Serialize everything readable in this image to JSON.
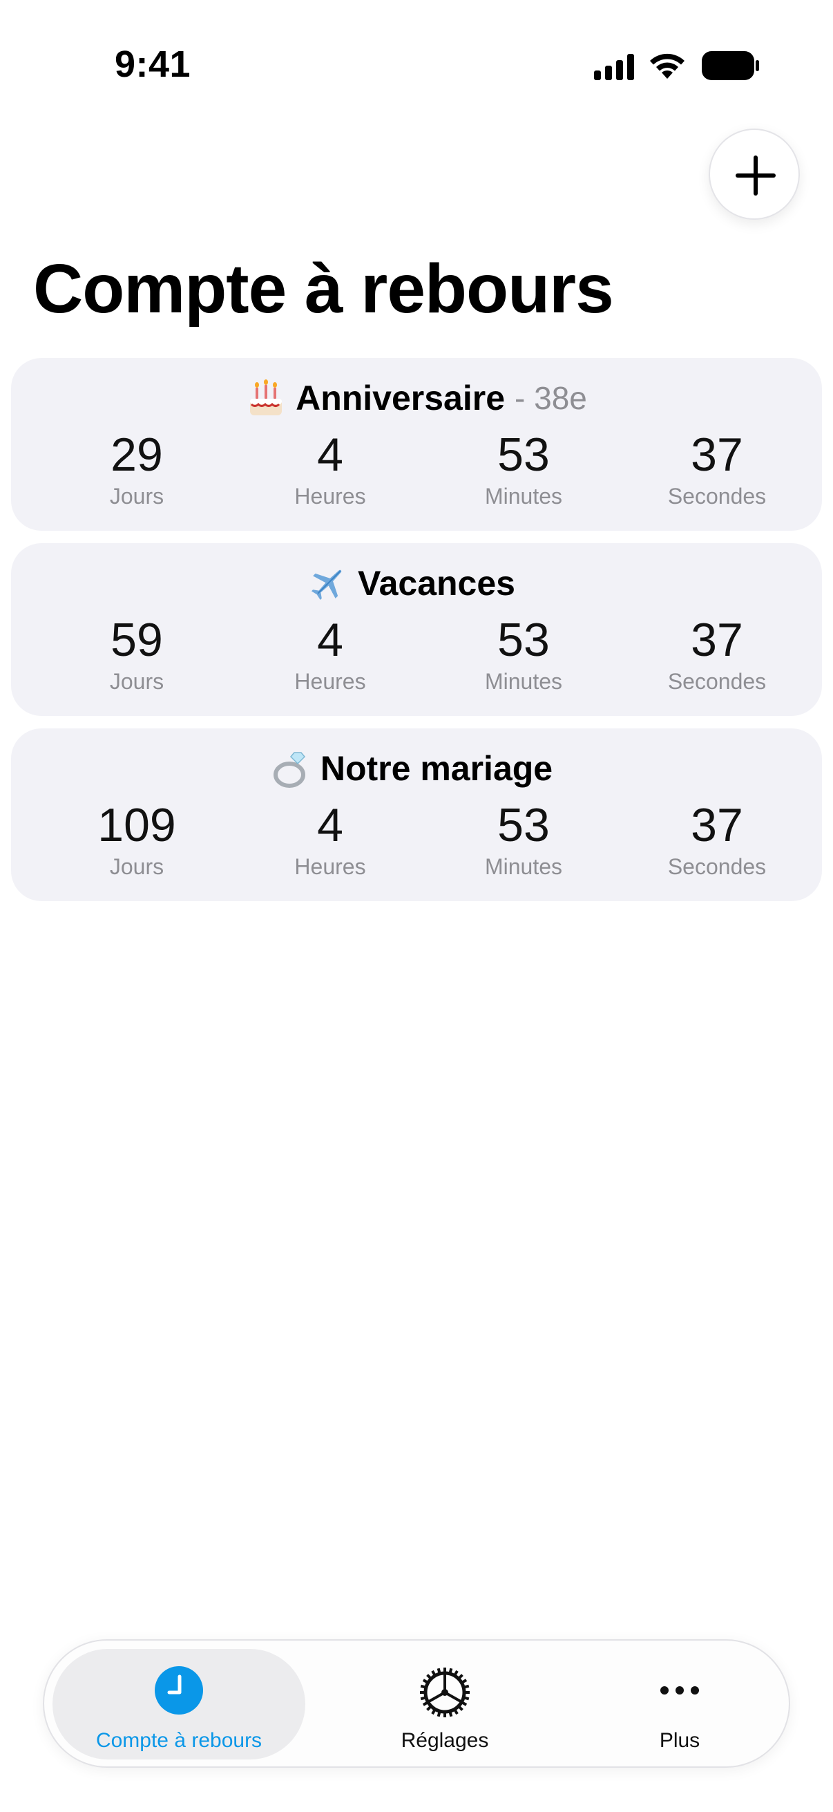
{
  "status_bar": {
    "time": "9:41",
    "icons": [
      "cellular-signal-icon",
      "wifi-icon",
      "battery-icon"
    ]
  },
  "header": {
    "add_icon": "plus-icon",
    "title": "Compte à rebours"
  },
  "countdowns": [
    {
      "emoji": "birthday-cake-icon",
      "title": "Anniversaire",
      "subtitle": "- 38e",
      "units": [
        {
          "value": "29",
          "label": "Jours"
        },
        {
          "value": "4",
          "label": "Heures"
        },
        {
          "value": "53",
          "label": "Minutes"
        },
        {
          "value": "37",
          "label": "Secondes"
        }
      ]
    },
    {
      "emoji": "airplane-icon",
      "title": "Vacances",
      "subtitle": "",
      "units": [
        {
          "value": "59",
          "label": "Jours"
        },
        {
          "value": "4",
          "label": "Heures"
        },
        {
          "value": "53",
          "label": "Minutes"
        },
        {
          "value": "37",
          "label": "Secondes"
        }
      ]
    },
    {
      "emoji": "ring-icon",
      "title": "Notre mariage",
      "subtitle": "",
      "units": [
        {
          "value": "109",
          "label": "Jours"
        },
        {
          "value": "4",
          "label": "Heures"
        },
        {
          "value": "53",
          "label": "Minutes"
        },
        {
          "value": "37",
          "label": "Secondes"
        }
      ]
    }
  ],
  "tab_bar": {
    "tabs": [
      {
        "label": "Compte à rebours",
        "icon": "clock-icon",
        "active": true
      },
      {
        "label": "Réglages",
        "icon": "gear-icon",
        "active": false
      },
      {
        "label": "Plus",
        "icon": "ellipsis-icon",
        "active": false
      }
    ]
  },
  "colors": {
    "accent": "#0a97e8",
    "card_background": "#f2f2f7",
    "secondary_text": "#8e8e93"
  }
}
